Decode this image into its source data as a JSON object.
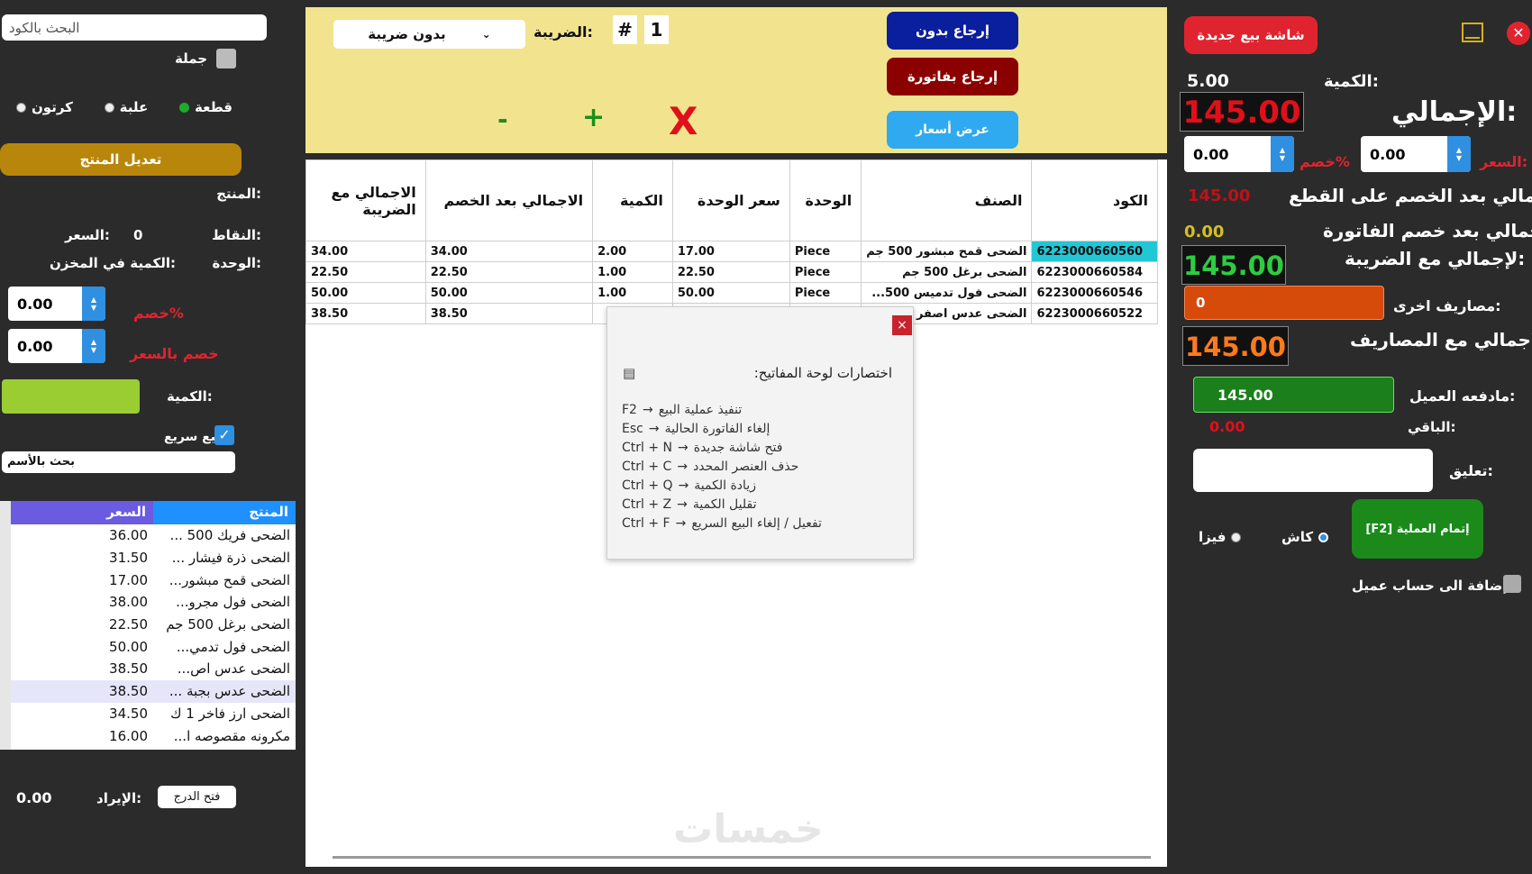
{
  "left": {
    "search_code_placeholder": "البحث بالكود",
    "wholesale_label": "جملة",
    "units": [
      "كرتون",
      "علبة",
      "قطعة"
    ],
    "edit_product_button": "تعديل المنتج",
    "product_label": "المنتج:",
    "points_label": "النقاط:",
    "price_label": "السعر:",
    "price_value": "0",
    "unit_label": "الوحدة:",
    "stock_label": "الكمية في المخزن:",
    "discount_pct_value": "0.00",
    "discount_pct_label": "خصم%",
    "discount_price_value": "0.00",
    "discount_price_label": "خصم بالسعر",
    "qty_label": "الكمية:",
    "quick_sale_label": "بيع سريع",
    "search_name_placeholder": "بحث بالأسم",
    "list_headers": {
      "product": "المنتج",
      "price": "السعر"
    },
    "list_rows": [
      {
        "name": "الضحى فريك 500 ...",
        "price": "36.00"
      },
      {
        "name": "الضحى ذرة فيشار ...",
        "price": "31.50"
      },
      {
        "name": "الضحى قمح مبشور...",
        "price": "17.00"
      },
      {
        "name": "الضحى فول مجرو...",
        "price": "38.00"
      },
      {
        "name": "الضحى برغل 500 جم",
        "price": "22.50"
      },
      {
        "name": "الضحى فول تدمي...",
        "price": "50.00"
      },
      {
        "name": "الضحى عدس اص...",
        "price": "38.50"
      },
      {
        "name": "الضحى عدس بجبة ...",
        "price": "38.50"
      },
      {
        "name": "الضحى ارز فاخر 1 ك",
        "price": "34.50"
      },
      {
        "name": "مكرونه مقصوصه ا...",
        "price": "16.00"
      }
    ],
    "income_value": "0.00",
    "income_label": "الإيراد:",
    "open_drawer_button": "فتح الدرج"
  },
  "toolbar": {
    "tax_label": "الضريبة:",
    "tax_selected": "بدون ضريبة",
    "hash": "#",
    "invoice_no": "1",
    "return_without_button": "إرجاع بدون",
    "return_invoice_button": "إرجاع بفاتورة",
    "quotation_button": "عرض أسعار",
    "minus": "-",
    "plus": "+",
    "delete": "X"
  },
  "grid": {
    "headers": [
      "الكود",
      "الصنف",
      "الوحدة",
      "سعر الوحدة",
      "الكمية",
      "الاجمالي بعد الخصم",
      "الاجمالي مع الضريبة"
    ],
    "rows": [
      [
        "6223000660560",
        "الضحى قمح مبشور 500 جم",
        "Piece",
        "17.00",
        "2.00",
        "34.00",
        "34.00"
      ],
      [
        "6223000660584",
        "الضحى برغل 500 جم",
        "Piece",
        "22.50",
        "1.00",
        "22.50",
        "22.50"
      ],
      [
        "6223000660546",
        "الضحى فول تدميس 500...",
        "Piece",
        "50.00",
        "1.00",
        "50.00",
        "50.00"
      ],
      [
        "6223000660522",
        "الضحى عدس اصفر",
        "",
        "",
        "",
        "38.50",
        "38.50"
      ]
    ]
  },
  "dialog": {
    "title": "اختصارات لوحة المفاتيح:",
    "shortcuts": [
      {
        "key": "F2",
        "action": "تنفيذ عملية البيع"
      },
      {
        "key": "Esc",
        "action": "إلغاء الفاتورة الحالية"
      },
      {
        "key": "Ctrl + N",
        "action": "فتح شاشة جديدة"
      },
      {
        "key": "Ctrl + C",
        "action": "حذف العنصر المحدد"
      },
      {
        "key": "Ctrl + Q",
        "action": "زيادة الكمية"
      },
      {
        "key": "Ctrl + Z",
        "action": "تقليل الكمية"
      },
      {
        "key": "Ctrl + F",
        "action": "تفعيل / إلغاء البيع السريع"
      }
    ],
    "arrow": "→",
    "close": "×"
  },
  "right": {
    "new_sale_button": "شاشة بيع جديدة",
    "qty_label": "الكمية:",
    "qty_value": "5.00",
    "total_label": "الإجمالي:",
    "total_value": "145.00",
    "price_label": "السعر:",
    "price_value": "0.00",
    "discount_label": "خصم%",
    "discount_value": "0.00",
    "after_item_discount_label": "إجمالي بعد الخصم على القطع:",
    "after_item_discount_value": "145.00",
    "after_invoice_discount_label": "لإجمالي بعد خصم الفاتورة:",
    "after_invoice_discount_value": "0.00",
    "with_tax_label": "لإجمالي مع الضريبة:",
    "with_tax_value": "145.00",
    "other_expenses_label": "مصاريف اخرى:",
    "other_expenses_value": "0",
    "with_expenses_label": "لإجمالي مع المصاريف:",
    "with_expenses_value": "145.00",
    "customer_paid_label": "مادفعه العميل:",
    "customer_paid_value": "145.00",
    "remaining_label": "الباقي:",
    "remaining_value": "0.00",
    "comment_label": "تعليق:",
    "complete_button": "[F2] إتمام العملية",
    "cash_label": "كاش",
    "visa_label": "فيزا",
    "add_to_customer_label": "إضافة الى حساب عميل"
  },
  "watermark": "خمسات",
  "colors": {
    "yellow_panel": "#f2e48e",
    "dark_bg": "#2b2b2b",
    "red": "#e0242f",
    "green": "#1b7f1b",
    "accent_blue": "#2f8fe0",
    "orange": "#d64a0a",
    "purple": "#6a5be0"
  }
}
